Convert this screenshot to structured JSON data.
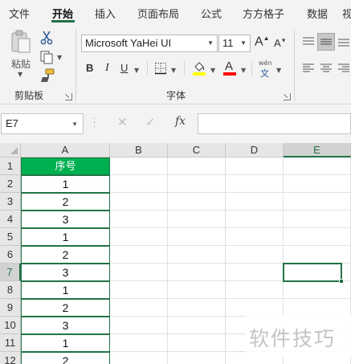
{
  "ribbon_tabs": [
    "文件",
    "开始",
    "插入",
    "页面布局",
    "公式",
    "方方格子",
    "数据",
    "视"
  ],
  "active_tab": "开始",
  "clipboard_group": {
    "paste_label": "粘贴",
    "group_label": "剪贴板",
    "icons": [
      "paste-icon",
      "cut-icon",
      "copy-icon",
      "format-painter-icon"
    ]
  },
  "font_group": {
    "group_label": "字体",
    "font_name": "Microsoft YaHei UI",
    "font_size": "11",
    "grow_label": "A",
    "shrink_label": "A",
    "bold_label": "B",
    "italic_label": "I",
    "underline_label": "U",
    "font_color_label": "A",
    "fill_color_hex": "#ffff00",
    "font_color_hex": "#ff0000",
    "phonetic_top": "wén",
    "phonetic_bottom": "文"
  },
  "formula_bar": {
    "name_box": "E7",
    "cancel_glyph": "✕",
    "enter_glyph": "✓",
    "fx_label": "fx",
    "formula": ""
  },
  "sheet": {
    "columns": [
      "A",
      "B",
      "C",
      "D",
      "E"
    ],
    "selected_column": "E",
    "rows": [
      "1",
      "2",
      "3",
      "4",
      "5",
      "6",
      "7",
      "8",
      "9",
      "10",
      "11",
      "12"
    ],
    "selected_row": "7",
    "selected_cell": "E7",
    "column_a": [
      "序号",
      "1",
      "2",
      "3",
      "1",
      "2",
      "3",
      "1",
      "2",
      "3",
      "1",
      "2"
    ],
    "header_fill_hex": "#00b050",
    "accent_hex": "#217346"
  },
  "watermark": "软件技巧"
}
